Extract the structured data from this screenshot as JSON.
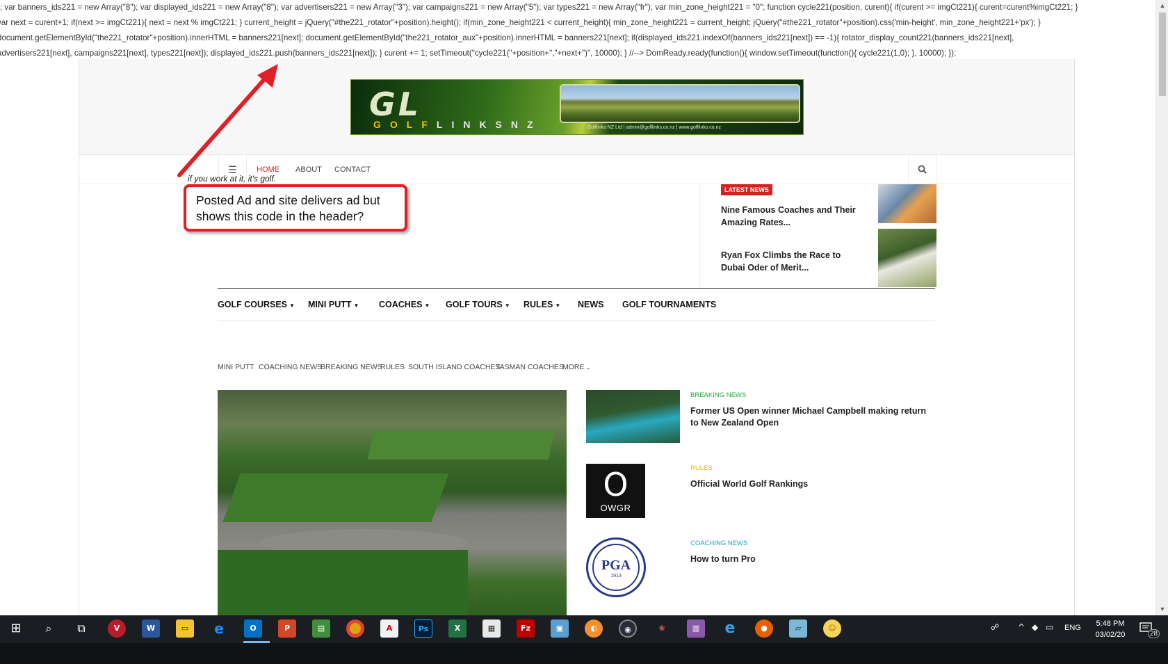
{
  "leaked_code": {
    "lines": [
      "); var banners_ids221 = new Array(\"8\"); var displayed_ids221 = new Array(\"8\"); var advertisers221 = new Array(\"3\"); var campaigns221 = new Array(\"5\"); var types221 = new Array(\"fr\"); var min_zone_height221 = \"0\"; function cycle221(position, curent){ if(curent >= imgCt221){ curent=curent%imgCt221; }",
      " var next = curent+1; if(next >= imgCt221){ next = next % imgCt221; } current_height = jQuery(\"#the221_rotator\"+position).height(); if(min_zone_height221 < current_height){ min_zone_height221 = current_height; jQuery(\"#the221_rotator\"+position).css('min-height', min_zone_height221+'px'); }",
      "document.getElementById(\"the221_rotator\"+position).innerHTML = banners221[next]; document.getElementById(\"the221_rotator_aux\"+position).innerHTML = banners221[next]; if(displayed_ids221.indexOf(banners_ids221[next]) == -1){ rotator_display_count221(banners_ids221[next],",
      "advertisers221[next], campaigns221[next], types221[next]); displayed_ids221.push(banners_ids221[next]); } curent += 1; setTimeout(\"cycle221(\"+position+\",\"+next+\")\", 10000); } //--> DomReady.ready(function(){ window.setTimeout(function(){ cycle221(1,0); }, 10000); });"
    ]
  },
  "banner": {
    "logo": "GL",
    "brand_gold": "GOLF",
    "brand_white": "LINKSNZ",
    "contact": "Golflinks NZ Ltd  |  admin@golflinks.co.nz  |  www.golflinks.co.nz"
  },
  "topnav": {
    "menu_icon": "☰",
    "items": [
      "HOME",
      "ABOUT",
      "CONTACT"
    ]
  },
  "tagline": "if you work at it, it's golf.",
  "annotation": "Posted Ad and site delivers ad but shows this code in the header?",
  "latest_news": {
    "badge": "LATEST NEWS",
    "items": [
      "Nine Famous Coaches and Their Amazing Rates...",
      "Ryan Fox Climbs the Race to Dubai Oder of Merit..."
    ]
  },
  "main_menu": [
    "GOLF COURSES",
    "MINI PUTT",
    "COACHES",
    "GOLF TOURS",
    "RULES",
    "NEWS",
    "GOLF TOURNAMENTS"
  ],
  "main_menu_carets": [
    true,
    true,
    true,
    true,
    true,
    false,
    false
  ],
  "subtabs": [
    "MINI PUTT",
    "COACHING NEWS",
    "BREAKING NEWS",
    "RULES",
    "SOUTH ISLAND COACHES",
    "TASMAN COACHES",
    "MORE"
  ],
  "articles": [
    {
      "category": "BREAKING NEWS",
      "title": "Former US Open winner Michael Campbell making return to New Zealand Open"
    },
    {
      "category": "RULES",
      "title": "Official World Golf Rankings",
      "thumb_big": "O",
      "thumb_small": "OWGR"
    },
    {
      "category": "COACHING NEWS",
      "title": "How to turn Pro",
      "thumb_big": "PGA",
      "thumb_small": "1913"
    }
  ],
  "taskbar": {
    "icons": [
      "windows-start",
      "search",
      "task-view",
      "antivirus",
      "word",
      "file-explorer",
      "edge",
      "outlook",
      "powerpoint",
      "green-app",
      "chrome",
      "acrobat",
      "photoshop",
      "excel",
      "calculator",
      "filezilla",
      "remote-desktop",
      "orange-app",
      "camera-app",
      "paint-app",
      "winrar",
      "internet-explorer",
      "firefox",
      "notes-app",
      "smiley-app"
    ],
    "language": "ENG",
    "time": "5:48 PM",
    "date": "03/02/20",
    "notifications": "28"
  },
  "colors": {
    "accent_red": "#d6211f",
    "breaking_green": "#28a745",
    "rules_yellow": "#f0b400",
    "coaching_teal": "#1aa3b8",
    "annotation_red": "#e21f26"
  }
}
